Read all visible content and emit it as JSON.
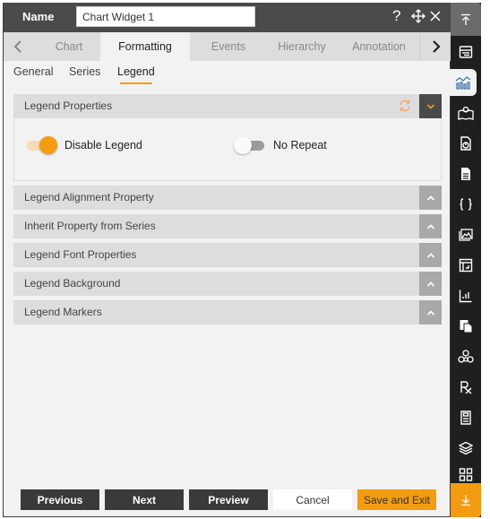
{
  "header": {
    "name_label": "Name",
    "name_value": "Chart Widget 1",
    "icons": [
      "help-icon",
      "move-icon",
      "close-icon"
    ]
  },
  "tabs": {
    "items": [
      {
        "label": "Chart",
        "active": false
      },
      {
        "label": "Formatting",
        "active": true
      },
      {
        "label": "Events",
        "active": false
      },
      {
        "label": "Hierarchy",
        "active": false
      },
      {
        "label": "Annotation",
        "active": false
      }
    ]
  },
  "subtabs": {
    "items": [
      {
        "label": "General",
        "active": false
      },
      {
        "label": "Series",
        "active": false
      },
      {
        "label": "Legend",
        "active": true
      }
    ]
  },
  "sections": [
    {
      "title": "Legend Properties",
      "expanded": true,
      "switches": [
        {
          "label": "Disable Legend",
          "on": true
        },
        {
          "label": "No Repeat",
          "on": false
        }
      ]
    },
    {
      "title": "Legend Alignment Property",
      "expanded": false
    },
    {
      "title": "Inherit Property from Series",
      "expanded": false
    },
    {
      "title": "Legend Font Properties",
      "expanded": false
    },
    {
      "title": "Legend Background",
      "expanded": false
    },
    {
      "title": "Legend Markers",
      "expanded": false
    }
  ],
  "footer": {
    "previous": "Previous",
    "next": "Next",
    "preview": "Preview",
    "cancel": "Cancel",
    "save_exit": "Save and Exit"
  },
  "sidebar": {
    "items": [
      "data-table-icon",
      "chart-icon",
      "map-icon",
      "report-icon",
      "document-icon",
      "code-braces-icon",
      "image-icon",
      "pivot-icon",
      "kpi-chart-icon",
      "copy-page-icon",
      "hierarchy-icon",
      "formula-icon",
      "save-file-icon",
      "layers-icon",
      "grid-icon"
    ],
    "active": "chart-icon"
  },
  "colors": {
    "accent": "#f39c12",
    "header_bg": "#4a4a4a",
    "sidebar_bg": "#1f1f1f"
  }
}
